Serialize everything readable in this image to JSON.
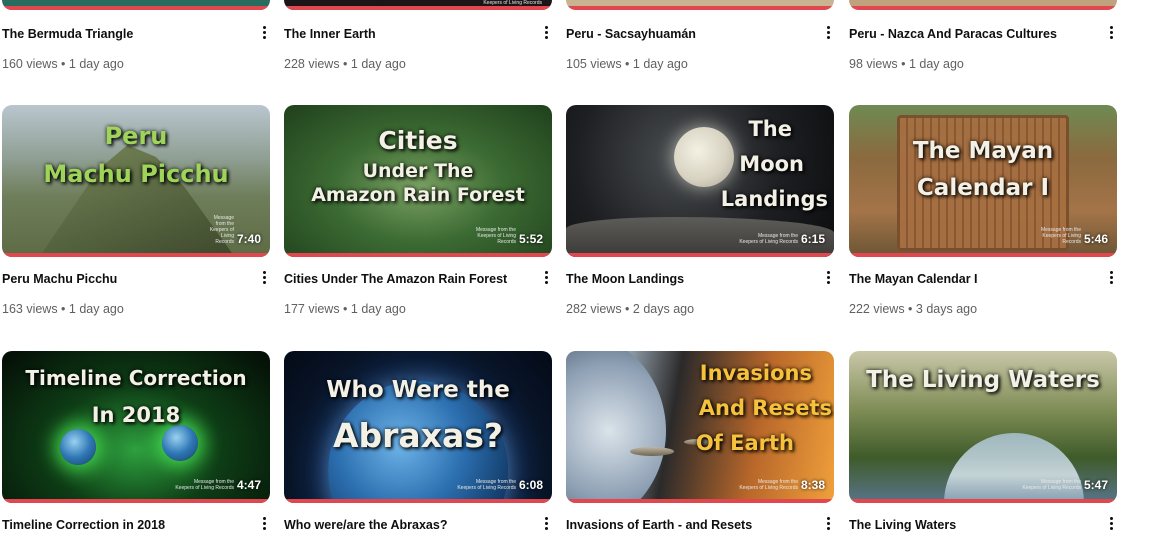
{
  "videos": [
    {
      "title": "The Bermuda Triangle",
      "meta": "160 views • 1 day ago",
      "duration": "",
      "thumb_lines": [],
      "watermark": ""
    },
    {
      "title": "The Inner Earth",
      "meta": "228 views • 1 day ago",
      "duration": "",
      "thumb_lines": [],
      "watermark": "Keepers of Living Records"
    },
    {
      "title": "Peru - Sacsayhuamán",
      "meta": "105 views • 1 day ago",
      "duration": "",
      "thumb_lines": [],
      "watermark": ""
    },
    {
      "title": "Peru - Nazca And Paracas Cultures",
      "meta": "98 views • 1 day ago",
      "duration": "",
      "thumb_lines": [],
      "watermark": ""
    },
    {
      "title": "Peru Machu Picchu",
      "meta": "163 views • 1 day ago",
      "duration": "7:40",
      "thumb_lines": [
        "Peru",
        "Machu Picchu"
      ],
      "watermark": "Message from the Keepers of Living Records"
    },
    {
      "title": "Cities Under The Amazon Rain Forest",
      "meta": "177 views • 1 day ago",
      "duration": "5:52",
      "thumb_lines": [
        "Cities",
        "Under The",
        "Amazon Rain Forest"
      ],
      "watermark": "Message from the Keepers of Living Records"
    },
    {
      "title": "The Moon Landings",
      "meta": "282 views • 2 days ago",
      "duration": "6:15",
      "thumb_lines": [
        "The",
        "Moon",
        "Landings"
      ],
      "watermark": "Message from the Keepers of Living Records"
    },
    {
      "title": "The Mayan Calendar I",
      "meta": "222 views • 3 days ago",
      "duration": "5:46",
      "thumb_lines": [
        "The Mayan",
        "Calendar I"
      ],
      "watermark": "Message from the Keepers of Living Records"
    },
    {
      "title": "Timeline Correction in 2018",
      "meta": "",
      "duration": "4:47",
      "thumb_lines": [
        "Timeline Correction",
        "In 2018"
      ],
      "watermark": "Message from the Keepers of Living Records"
    },
    {
      "title": "Who were/are the Abraxas?",
      "meta": "",
      "duration": "6:08",
      "thumb_lines": [
        "Who Were the",
        "Abraxas?"
      ],
      "watermark": "Message from the Keepers of Living Records"
    },
    {
      "title": "Invasions of Earth - and Resets",
      "meta": "",
      "duration": "8:38",
      "thumb_lines": [
        "Invasions",
        "And Resets",
        "Of Earth"
      ],
      "watermark": "Message from the Keepers of Living Records"
    },
    {
      "title": "The Living Waters",
      "meta": "",
      "duration": "5:47",
      "thumb_lines": [
        "The Living Waters"
      ],
      "watermark": "Message from the Keepers of Living Records"
    }
  ],
  "colors": {
    "progress": "#e0474f",
    "title": "#0f0f0f",
    "meta": "#606060"
  },
  "icons": {
    "menu": "more-vert-icon"
  }
}
